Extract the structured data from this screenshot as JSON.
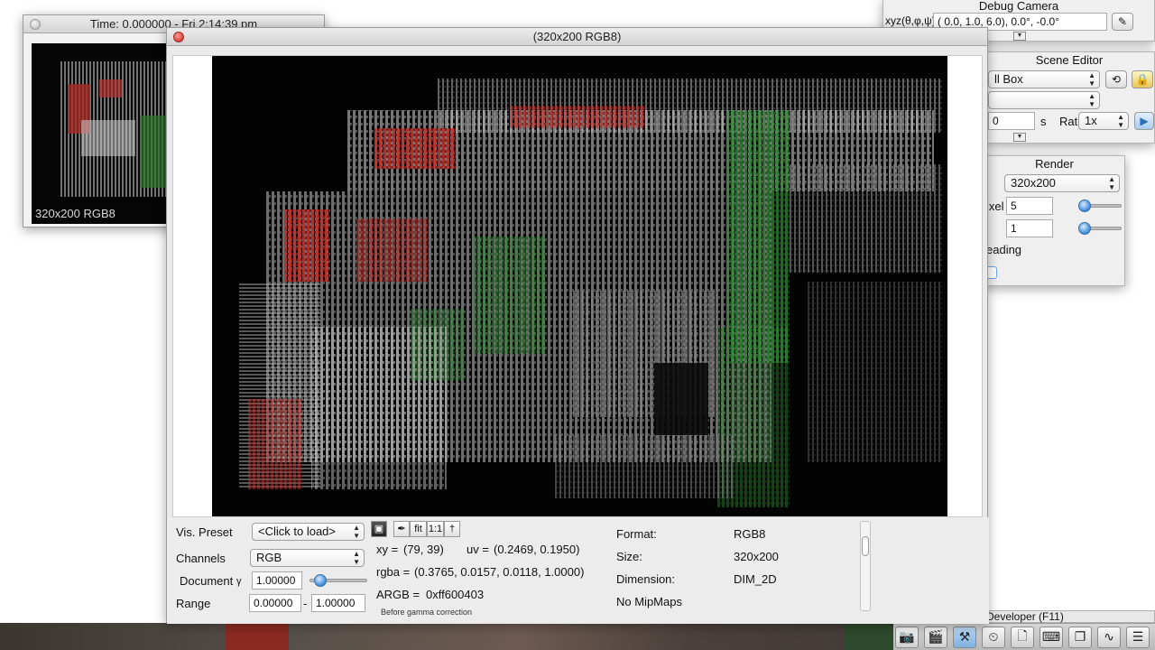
{
  "thumbnail": {
    "title": "Time: 0.000000 - Fri 2:14:39 pm",
    "label": "320x200 RGB8"
  },
  "camera": {
    "title": "Debug Camera",
    "xyz_label": "xyz(θ,φ,ψ):",
    "xyz_value": "(  0.0,   1.0,   6.0),   0.0°,  -0.0°"
  },
  "scene_editor": {
    "title": "Scene Editor",
    "scene_select": "ll Box",
    "second_select": "",
    "time_value": "0",
    "time_unit": "s",
    "rate_label": "Rate",
    "rate_value": "1x"
  },
  "render": {
    "title": "Render",
    "resolution": "320x200",
    "pixel_label": "ixel",
    "pixel_value": "5",
    "second_value": "1",
    "shading_label": "eading"
  },
  "dev_bar": {
    "title": "Developer (F11)",
    "icons": [
      "camera-icon",
      "film-icon",
      "tools-icon",
      "clock-icon",
      "note-icon",
      "terminal-icon",
      "windows-icon",
      "graph-icon",
      "page-icon"
    ]
  },
  "main_window": {
    "title": "(320x200 RGB8)",
    "vis_preset_label": "Vis. Preset",
    "vis_preset_value": "<Click to load>",
    "channels_label": "Channels",
    "channels_value": "RGB",
    "document_label": "Document",
    "gamma_symbol": "γ",
    "gamma_value": "1.00000",
    "range_label": "Range",
    "range_min": "0.00000",
    "range_sep": "-",
    "range_max": "1.00000",
    "toolbar": {
      "fit": "fit",
      "one_to_one": "1:1"
    },
    "xy_label": "xy =",
    "xy_value": "(79, 39)",
    "uv_label": "uv =",
    "uv_value": "(0.2469, 0.1950)",
    "rgba_label": "rgba =",
    "rgba_value": "(0.3765, 0.0157, 0.0118, 1.0000)",
    "argb_label": "ARGB =",
    "argb_value": "0xff600403",
    "gamma_note": "Before gamma correction",
    "format_label": "Format:",
    "format_value": "RGB8",
    "size_label": "Size:",
    "size_value": "320x200",
    "dimension_label": "Dimension:",
    "dimension_value": "DIM_2D",
    "mipmaps": "No MipMaps"
  },
  "colors": {
    "accent": "#3b8ad9",
    "close": "#d7443a"
  }
}
